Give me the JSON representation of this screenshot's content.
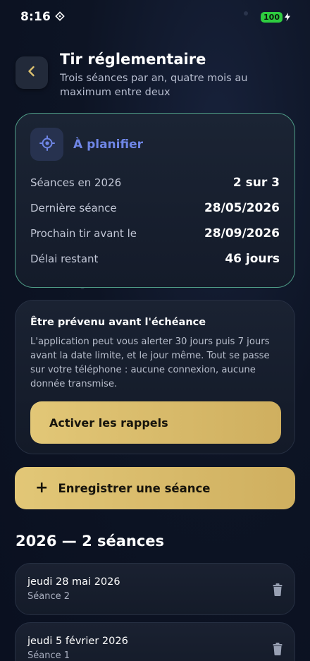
{
  "status_bar": {
    "time": "8:16",
    "battery": "100"
  },
  "header": {
    "title": "Tir réglementaire",
    "subtitle": "Trois séances par an, quatre mois au maximum entre deux"
  },
  "status_card": {
    "label": "À planifier",
    "rows": [
      {
        "label": "Séances en 2026",
        "value": "2 sur 3"
      },
      {
        "label": "Dernière séance",
        "value": "28/05/2026"
      },
      {
        "label": "Prochain tir avant le",
        "value": "28/09/2026"
      },
      {
        "label": "Délai restant",
        "value": "46 jours"
      }
    ]
  },
  "reminder_card": {
    "title": "Être prévenu avant l'échéance",
    "body": "L'application peut vous alerter 30 jours puis 7 jours avant la date limite, et le jour même. Tout se passe sur votre téléphone : aucune connexion, aucune donnée transmise.",
    "button": "Activer les rappels"
  },
  "record_button": {
    "icon": "+",
    "label": "Enregistrer une séance"
  },
  "year_heading": "2026 — 2 séances",
  "sessions": [
    {
      "date": "jeudi 28 mai 2026",
      "name": "Séance 2"
    },
    {
      "date": "jeudi 5 février 2026",
      "name": "Séance 1"
    }
  ],
  "colors": {
    "accent_gold": "#dcc06f",
    "status_blue": "#6f86e6",
    "card_border_green": "#4d9a85",
    "battery_green": "#2ecc40"
  }
}
